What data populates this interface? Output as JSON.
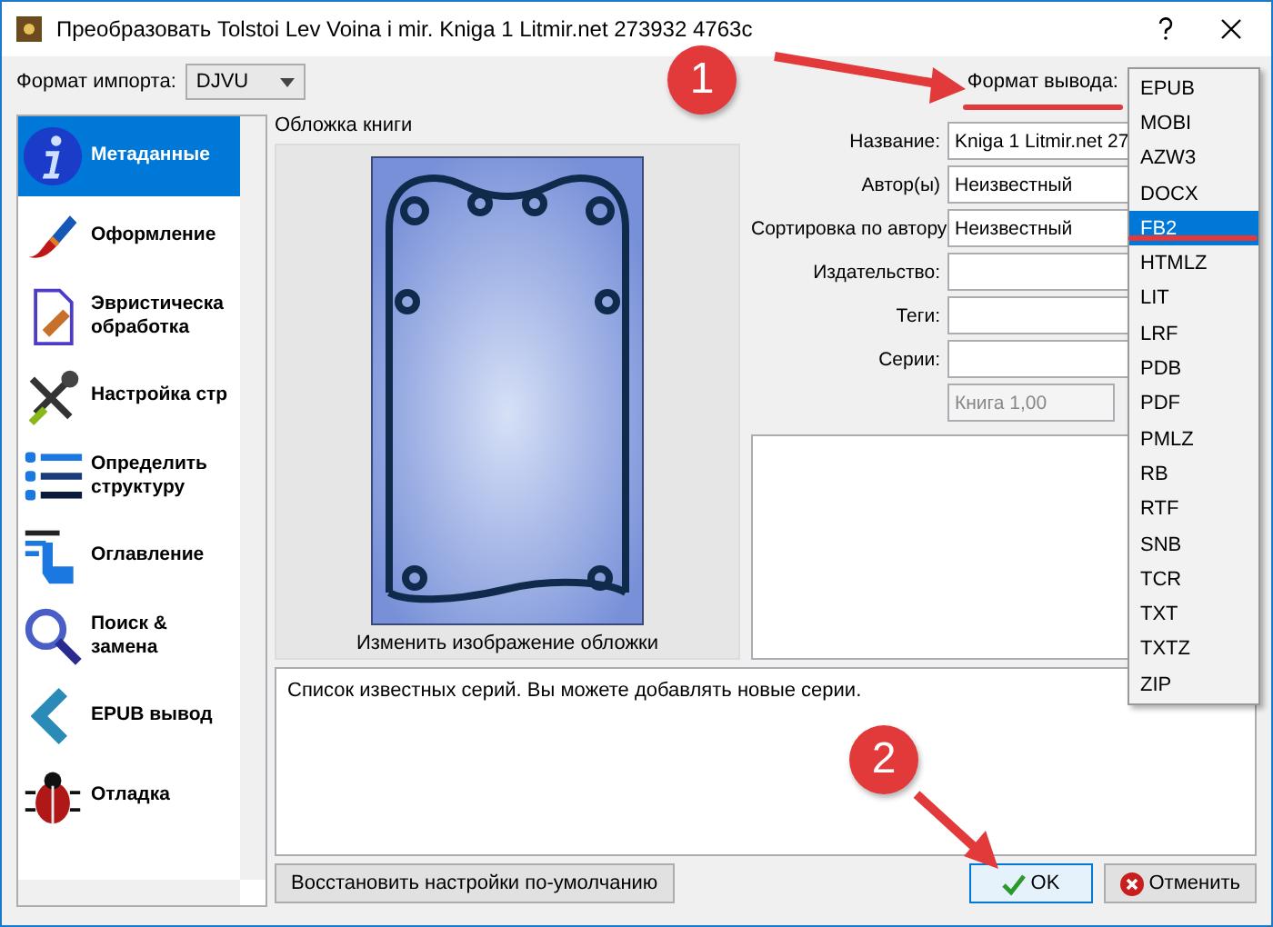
{
  "window": {
    "title": "Преобразовать Tolstoi Lev Voina i mir. Kniga 1 Litmir.net 273932 4763c"
  },
  "import_format": {
    "label": "Формат импорта:",
    "value": "DJVU"
  },
  "output_format": {
    "label": "Формат вывода:",
    "options": [
      {
        "label": "EPUB",
        "selected": false
      },
      {
        "label": "MOBI",
        "selected": false
      },
      {
        "label": "AZW3",
        "selected": false
      },
      {
        "label": "DOCX",
        "selected": false
      },
      {
        "label": "FB2",
        "selected": true
      },
      {
        "label": "HTMLZ",
        "selected": false
      },
      {
        "label": "LIT",
        "selected": false
      },
      {
        "label": "LRF",
        "selected": false
      },
      {
        "label": "PDB",
        "selected": false
      },
      {
        "label": "PDF",
        "selected": false
      },
      {
        "label": "PMLZ",
        "selected": false
      },
      {
        "label": "RB",
        "selected": false
      },
      {
        "label": "RTF",
        "selected": false
      },
      {
        "label": "SNB",
        "selected": false
      },
      {
        "label": "TCR",
        "selected": false
      },
      {
        "label": "TXT",
        "selected": false
      },
      {
        "label": "TXTZ",
        "selected": false
      },
      {
        "label": "ZIP",
        "selected": false
      }
    ]
  },
  "sidebar": {
    "items": [
      {
        "label": "Метаданные",
        "selected": true
      },
      {
        "label": "Оформление",
        "selected": false
      },
      {
        "label": "Эвристическа\nобработка",
        "selected": false
      },
      {
        "label": "Настройка стр",
        "selected": false
      },
      {
        "label": "Определить\nструктуру",
        "selected": false
      },
      {
        "label": "Оглавление",
        "selected": false
      },
      {
        "label": "Поиск &\nзамена",
        "selected": false
      },
      {
        "label": "EPUB вывод",
        "selected": false
      },
      {
        "label": "Отладка",
        "selected": false
      }
    ]
  },
  "cover": {
    "title": "Обложка книги",
    "caption": "Изменить изображение обложки"
  },
  "metadata": {
    "fields": [
      {
        "label": "Название:",
        "value": "Kniga 1 Litmir.net 27",
        "disabled": false
      },
      {
        "label": "Автор(ы)",
        "value": "Неизвестный",
        "disabled": false
      },
      {
        "label": "Сортировка по автору",
        "value": "Неизвестный",
        "disabled": false
      },
      {
        "label": "Издательство:",
        "disabled": false
      },
      {
        "label": "Теги:",
        "disabled": false
      },
      {
        "label": "Серии:",
        "disabled": false
      },
      {
        "value": "Книга 1,00",
        "disabled": true
      }
    ]
  },
  "help_text": "Список известных серий. Вы можете добавлять новые серии.",
  "buttons": {
    "restore": "Восстановить настройки по-умолчанию",
    "ok": "OK",
    "cancel": "Отменить"
  },
  "annotations": [
    {
      "label": "1"
    },
    {
      "label": "2"
    }
  ]
}
